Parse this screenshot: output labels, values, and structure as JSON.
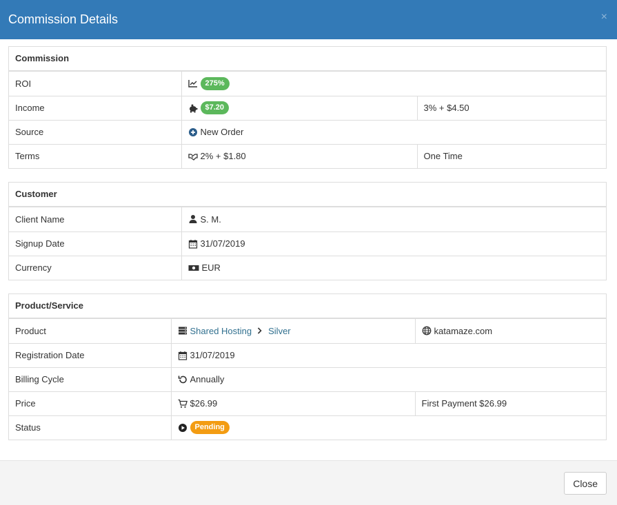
{
  "modal": {
    "title": "Commission Details",
    "close_x": "×",
    "close_button": "Close"
  },
  "commission": {
    "heading": "Commission",
    "roi_label": "ROI",
    "roi_value": "275%",
    "income_label": "Income",
    "income_value": "$7.20",
    "income_rate": "3% + $4.50",
    "source_label": "Source",
    "source_value": "New Order",
    "terms_label": "Terms",
    "terms_value": "2% + $1.80",
    "terms_type": "One Time"
  },
  "customer": {
    "heading": "Customer",
    "client_label": "Client Name",
    "client_value": "S. M.",
    "signup_label": "Signup Date",
    "signup_value": "31/07/2019",
    "currency_label": "Currency",
    "currency_value": "EUR"
  },
  "product": {
    "heading": "Product/Service",
    "product_label": "Product",
    "product_group": "Shared Hosting",
    "product_name": "Silver",
    "domain": "katamaze.com",
    "reg_label": "Registration Date",
    "reg_value": "31/07/2019",
    "cycle_label": "Billing Cycle",
    "cycle_value": "Annually",
    "price_label": "Price",
    "price_value": "$26.99",
    "first_payment": "First Payment $26.99",
    "status_label": "Status",
    "status_value": "Pending"
  },
  "colors": {
    "header_bg": "#337ab7",
    "badge_green": "#5cb85c",
    "badge_orange": "#f39c12",
    "link": "#31708f"
  }
}
